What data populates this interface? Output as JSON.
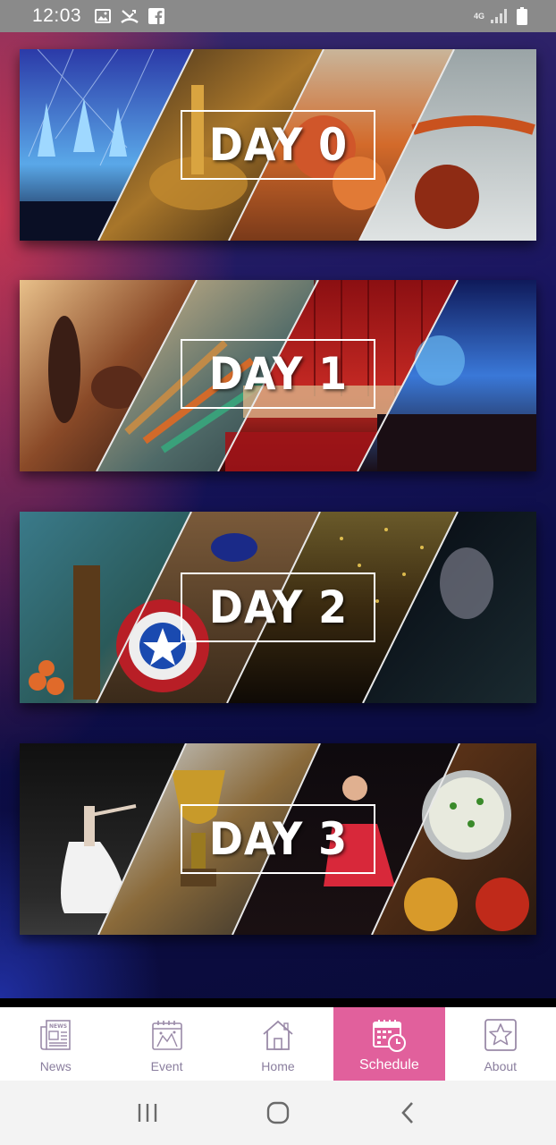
{
  "status_bar": {
    "time": "12:03",
    "network_label": "4G",
    "icons": [
      "gallery-icon",
      "missed-call-icon",
      "facebook-icon",
      "signal-icon",
      "battery-icon"
    ]
  },
  "days": [
    {
      "label": "DAY 0",
      "image_theme": [
        "concert-lights",
        "brass-lamp",
        "drum-procession",
        "veena-instrument"
      ]
    },
    {
      "label": "DAY 1",
      "image_theme": [
        "rock-band",
        "paint-brushes",
        "theatre-stage",
        "crowd-lasers"
      ]
    },
    {
      "label": "DAY 2",
      "image_theme": [
        "decorated-classroom",
        "captain-shield-costume",
        "confetti-stage",
        "singer-microphone"
      ]
    },
    {
      "label": "DAY 3",
      "image_theme": [
        "ballet-dancer",
        "trophy-award",
        "red-dress-performer",
        "thali-food"
      ]
    }
  ],
  "bottom_nav": {
    "items": [
      {
        "label": "News",
        "icon": "newspaper-icon",
        "active": false
      },
      {
        "label": "Event",
        "icon": "calendar-event-icon",
        "active": false
      },
      {
        "label": "Home",
        "icon": "home-icon",
        "active": false
      },
      {
        "label": "Schedule",
        "icon": "schedule-calendar-clock-icon",
        "active": true
      },
      {
        "label": "About",
        "icon": "star-icon",
        "active": false
      }
    ],
    "active_color": "#e1609c",
    "label_color": "#8a7e9e"
  },
  "system_nav": {
    "buttons": [
      "recent-apps-icon",
      "home-circle-icon",
      "back-chevron-icon"
    ]
  }
}
